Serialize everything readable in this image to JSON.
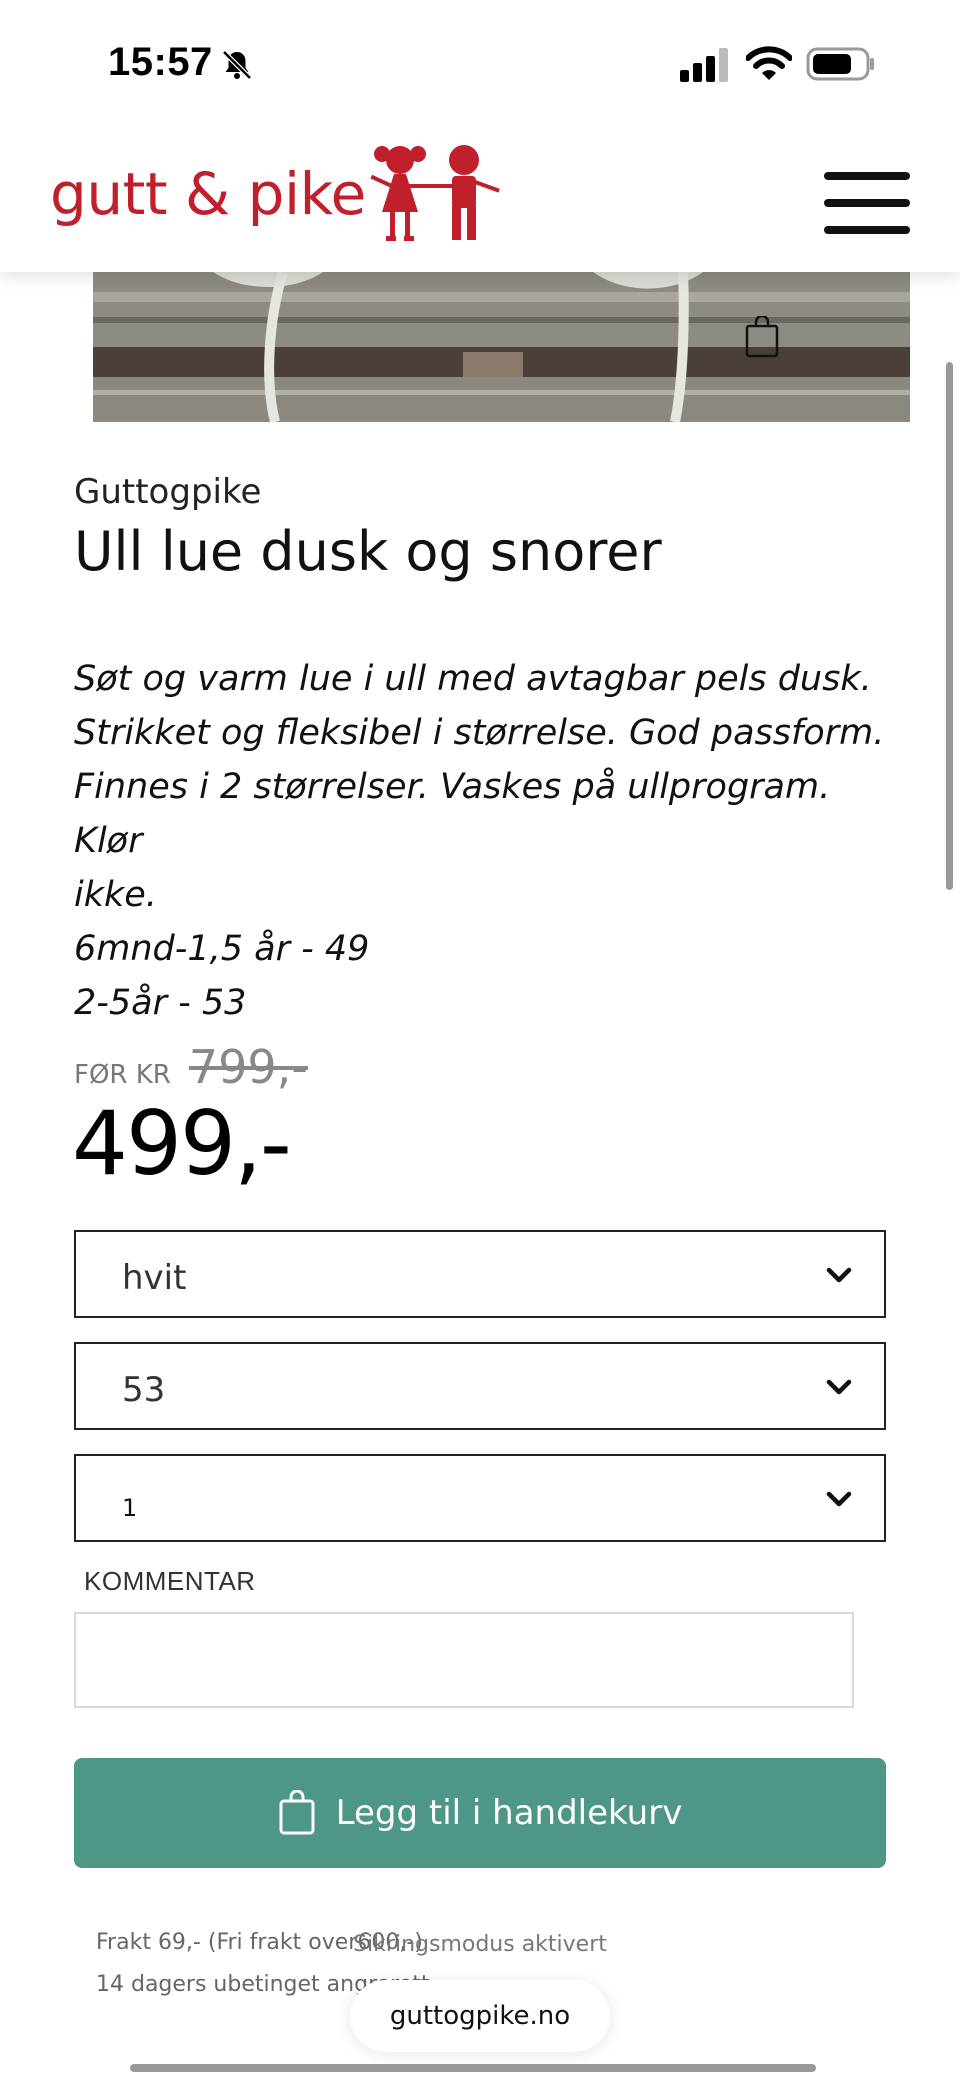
{
  "status_bar": {
    "time": "15:57",
    "icons": [
      "bell-slash-icon",
      "cellular-signal-icon",
      "wifi-icon",
      "battery-icon"
    ]
  },
  "header": {
    "logo_text": "gutt & pike",
    "logo_icon": "boy-and-girl-figures-icon",
    "menu_icon": "hamburger-menu-icon",
    "brand_color": "#c0202b"
  },
  "product": {
    "brand": "Guttogpike",
    "title": "Ull lue dusk og snorer",
    "description": [
      "Søt og varm lue i ull med avtagbar pels dusk.",
      "Strikket og fleksibel i størrelse. God passform.",
      "Finnes i 2 størrelser. Vaskes på ullprogram. Klør",
      "ikke.",
      "6mnd-1,5 år - 49",
      "2-5år - 53"
    ],
    "old_price_label": "FØR KR",
    "old_price": "799,-",
    "price": "499,-"
  },
  "options": {
    "color": "hvit",
    "size": "53",
    "quantity": "1"
  },
  "comment": {
    "label": "KOMMENTAR",
    "value": ""
  },
  "add_to_cart": {
    "label": "Legg til i handlekurv",
    "color": "#4e9685"
  },
  "shipping": {
    "line1": "Frakt 69,- (Fri frakt over600,-)",
    "line2": "14 dagers ubetinget angrerett"
  },
  "browser": {
    "toast": "Sikringsmodus aktivert",
    "url": "guttogpike.no"
  }
}
